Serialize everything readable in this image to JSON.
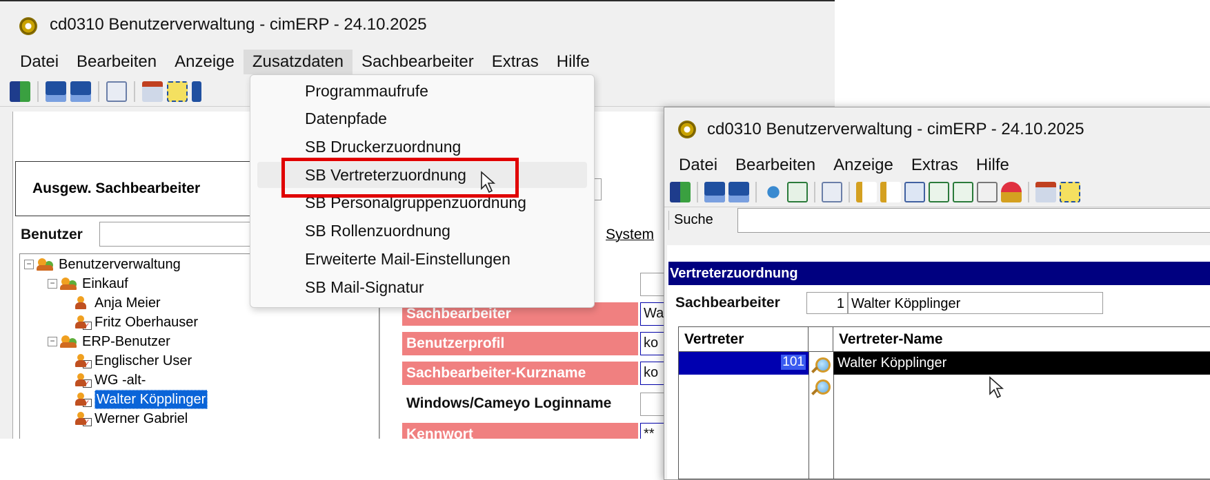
{
  "back_window": {
    "title": "cd0310 Benutzerverwaltung - cimERP - 24.10.2025",
    "menu": [
      "Datei",
      "Bearbeiten",
      "Anzeige",
      "Zusatzdaten",
      "Sachbearbeiter",
      "Extras",
      "Hilfe"
    ],
    "group_label": "Ausgew. Sachbearbeiter",
    "benutzer_label": "Benutzer",
    "system_label": "System",
    "tree": {
      "root": "Benutzerverwaltung",
      "group1": "Einkauf",
      "g1_items": [
        "Anja Meier",
        "Fritz Oberhauser"
      ],
      "group2": "ERP-Benutzer",
      "g2_items": [
        "Englischer User",
        "WG -alt-",
        "Walter Köpplinger",
        "Werner Gabriel"
      ]
    },
    "fields": {
      "sachbearbeiter": "Sachbearbeiter",
      "sachbearbeiter_val": "Wa",
      "benutzerprofil": "Benutzerprofil",
      "benutzerprofil_val": "ko",
      "kurzname": "Sachbearbeiter-Kurzname",
      "kurzname_val": "ko",
      "windows_login": "Windows/Cameyo Loginname",
      "kennwort": "Kennwort",
      "kennwort_val": "**"
    }
  },
  "dropdown": {
    "items": [
      "Programmaufrufe",
      "Datenpfade",
      "SB Druckerzuordnung",
      "SB Vertreterzuordnung",
      "SB Personalgruppenzuordnung",
      "SB Rollenzuordnung",
      "Erweiterte Mail-Einstellungen",
      "SB Mail-Signatur"
    ],
    "highlighted": "SB Vertreterzuordnung"
  },
  "front_window": {
    "title": "cd0310 Benutzerverwaltung - cimERP - 24.10.2025",
    "menu": [
      "Datei",
      "Bearbeiten",
      "Anzeige",
      "Extras",
      "Hilfe"
    ],
    "search_label": "Suche",
    "section_title": "Vertreterzuordnung",
    "sachbearbeiter_label": "Sachbearbeiter",
    "sachbearbeiter_nr": "1",
    "sachbearbeiter_name": "Walter Köpplinger",
    "grid": {
      "headers": [
        "Vertreter",
        "",
        "Vertreter-Name"
      ],
      "rows": [
        {
          "nr": "101",
          "name": "Walter Köpplinger"
        }
      ]
    }
  },
  "colors": {
    "selection": "#0a64d8",
    "section_header": "#000080",
    "required_field": "#f08080",
    "highlight_box": "#e00000"
  }
}
